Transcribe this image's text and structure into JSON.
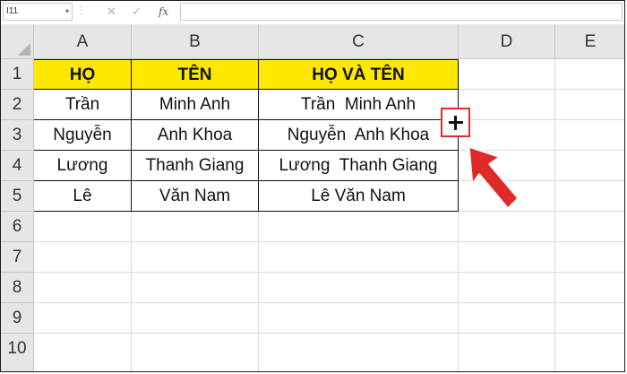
{
  "formula_bar": {
    "name_box": "I11",
    "cancel_icon": "close-icon",
    "enter_icon": "check-icon",
    "fx_label": "fx",
    "formula": ""
  },
  "columns": [
    "A",
    "B",
    "C",
    "D",
    "E"
  ],
  "rows": [
    "1",
    "2",
    "3",
    "4",
    "5",
    "6",
    "7",
    "8",
    "9",
    "10"
  ],
  "table": {
    "headers": [
      "HỌ",
      "TÊN",
      "HỌ VÀ TÊN"
    ],
    "rows": [
      [
        "Trần",
        "Minh Anh",
        "Trần  Minh Anh"
      ],
      [
        "Nguyễn",
        "Anh Khoa",
        "Nguyễn  Anh Khoa"
      ],
      [
        "Lương",
        "Thanh Giang",
        "Lương  Thanh Giang"
      ],
      [
        "Lê",
        "Văn Nam",
        "Lê Văn Nam"
      ]
    ]
  },
  "colors": {
    "header_fill": "#ffe800",
    "annotation_red": "#e02a2a"
  },
  "annotations": {
    "fill_handle_icon": "plus-icon",
    "pointer_icon": "arrow-icon"
  }
}
